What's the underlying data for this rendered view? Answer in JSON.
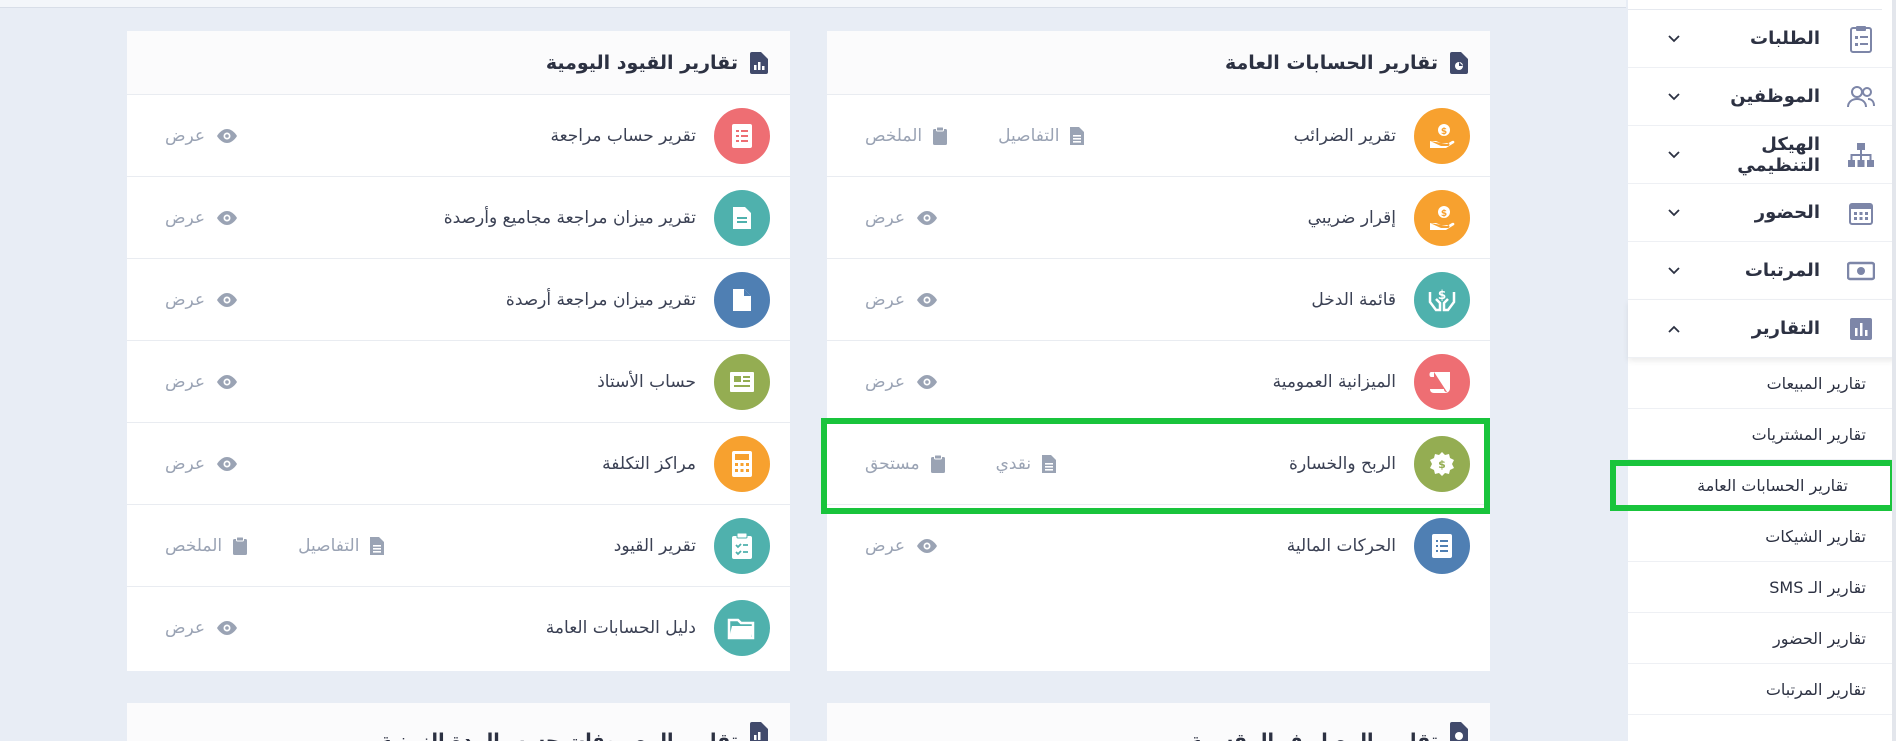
{
  "sidebar": {
    "menu": [
      {
        "label": "الطلبات",
        "icon": "clipboard-list-icon"
      },
      {
        "label": "الموظفين",
        "icon": "users-icon"
      },
      {
        "label": "الهيكل التنظيمي",
        "icon": "sitemap-icon"
      },
      {
        "label": "الحضور",
        "icon": "calendar-icon"
      },
      {
        "label": "المرتبات",
        "icon": "money-bill-icon"
      },
      {
        "label": "التقارير",
        "icon": "bar-chart-icon"
      }
    ],
    "submenu": [
      "تقارير المبيعات",
      "تقارير المشتريات",
      "تقارير الحسابات العامة",
      "تقارير الشيكات",
      "تقارير الـ SMS",
      "تقارير الحضور",
      "تقارير المرتبات"
    ]
  },
  "panels": {
    "general": {
      "title": "تقارير الحسابات العامة",
      "rows": [
        {
          "name": "تقرير الضرائب",
          "color": "#f7a12f",
          "actions": [
            "الملخص",
            "التفاصيل"
          ]
        },
        {
          "name": "إقرار ضريبي",
          "color": "#f7a12f",
          "actions": [
            "عرض"
          ]
        },
        {
          "name": "قائمة الدخل",
          "color": "#4fb1ad",
          "actions": [
            "عرض"
          ]
        },
        {
          "name": "الميزانية العمومية",
          "color": "#ee6e73",
          "actions": [
            "عرض"
          ]
        },
        {
          "name": "الربح والخسارة",
          "color": "#94ad52",
          "actions": [
            "مستحق",
            "نقدي"
          ]
        },
        {
          "name": "الحركات المالية",
          "color": "#4f7fb3",
          "actions": [
            "عرض"
          ]
        }
      ]
    },
    "daily": {
      "title": "تقارير القيود اليومية",
      "rows": [
        {
          "name": "تقرير حساب مراجعة",
          "color": "#ee6e73",
          "actions": [
            "عرض"
          ]
        },
        {
          "name": "تقرير ميزان مراجعة مجاميع وأرصدة",
          "color": "#4fb1ad",
          "actions": [
            "عرض"
          ]
        },
        {
          "name": "تقرير ميزان مراجعة أرصدة",
          "color": "#4f7fb3",
          "actions": [
            "عرض"
          ]
        },
        {
          "name": "حساب الأستاذ",
          "color": "#94ad52",
          "actions": [
            "عرض"
          ]
        },
        {
          "name": "مراكز التكلفة",
          "color": "#f7a12f",
          "actions": [
            "عرض"
          ]
        },
        {
          "name": "تقرير القيود",
          "color": "#4fb1ad",
          "actions": [
            "الملخص",
            "التفاصيل"
          ]
        },
        {
          "name": "دليل الحسابات العامة",
          "color": "#4fb1ad",
          "actions": [
            "عرض"
          ]
        }
      ]
    },
    "split": {
      "title": "تقارير المصاريف المقسمة"
    },
    "period": {
      "title": "تقارير المصروفات حسب المدة الزمنية"
    }
  }
}
